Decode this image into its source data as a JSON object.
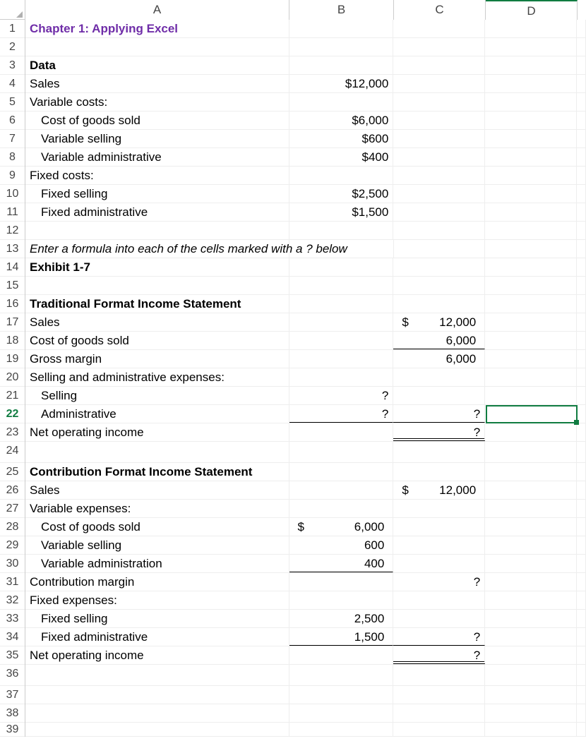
{
  "columns": {
    "A": "A",
    "B": "B",
    "C": "C",
    "D": "D",
    "E": ""
  },
  "rows": {
    "1": {
      "A": "Chapter 1: Applying Excel"
    },
    "2": {},
    "3": {
      "A": "Data"
    },
    "4": {
      "A": "Sales",
      "B": "$12,000"
    },
    "5": {
      "A": "Variable costs:"
    },
    "6": {
      "A": "Cost of goods sold",
      "B": "$6,000"
    },
    "7": {
      "A": "Variable selling",
      "B": "$600"
    },
    "8": {
      "A": "Variable administrative",
      "B": "$400"
    },
    "9": {
      "A": "Fixed costs:"
    },
    "10": {
      "A": "Fixed selling",
      "B": "$2,500"
    },
    "11": {
      "A": "Fixed administrative",
      "B": "$1,500"
    },
    "12": {},
    "13": {
      "A": "Enter a formula into each of the cells marked with a ? below"
    },
    "14": {
      "A": "Exhibit 1-7"
    },
    "15": {},
    "16": {
      "A": "Traditional Format Income Statement"
    },
    "17": {
      "A": "Sales",
      "C_sym": "$",
      "C_num": "12,000"
    },
    "18": {
      "A": "Cost of goods sold",
      "C_num": "6,000"
    },
    "19": {
      "A": "Gross margin",
      "C_num": "6,000"
    },
    "20": {
      "A": "Selling and administrative expenses:"
    },
    "21": {
      "A": "Selling",
      "B": "?"
    },
    "22": {
      "A": "Administrative",
      "B": "?",
      "C": "?"
    },
    "23": {
      "A": "Net operating income",
      "C": "?"
    },
    "24": {},
    "25": {
      "A": "Contribution Format Income Statement"
    },
    "26": {
      "A": "Sales",
      "C_sym": "$",
      "C_num": "12,000"
    },
    "27": {
      "A": "Variable expenses:"
    },
    "28": {
      "A": "Cost of goods sold",
      "B_sym": "$",
      "B_num": "6,000"
    },
    "29": {
      "A": "Variable selling",
      "B_num": "600"
    },
    "30": {
      "A": "Variable administration",
      "B_num": "400"
    },
    "31": {
      "A": "Contribution margin",
      "C": "?"
    },
    "32": {
      "A": "Fixed expenses:"
    },
    "33": {
      "A": "Fixed selling",
      "B_num": "2,500"
    },
    "34": {
      "A": "Fixed administrative",
      "B_num": "1,500",
      "C": "?"
    },
    "35": {
      "A": "Net operating income",
      "C": "?"
    },
    "36": {},
    "37": {},
    "38": {},
    "39": {}
  },
  "active_cell": "D22",
  "active_row": 22
}
